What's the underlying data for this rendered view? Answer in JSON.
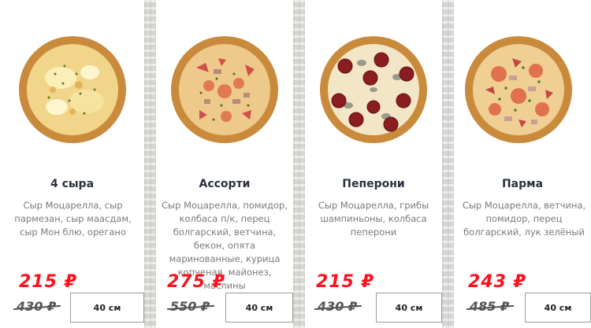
{
  "products": [
    {
      "name": "4 сыра",
      "description": "Сыр Моцарелла, сыр пармезан, сыр маасдам, сыр Мон блю, орегано",
      "price": "215 ₽",
      "old_price": "430 ₽",
      "size": "40 см",
      "image_icon": "pizza-four-cheese"
    },
    {
      "name": "Ассорти",
      "description": "Сыр Моцарелла, помидор, колбаса п/к, перец болгарский, ветчина, бекон, опята маринованные, курица копченая, майонез, маслины",
      "price": "275 ₽",
      "old_price": "550 ₽",
      "size": "40 см",
      "image_icon": "pizza-assorti"
    },
    {
      "name": "Пеперони",
      "description": "Сыр Моцарелла, грибы шампиньоны, колбаса пеперони",
      "price": "215 ₽",
      "old_price": "430 ₽",
      "size": "40 см",
      "image_icon": "pizza-pepperoni"
    },
    {
      "name": "Парма",
      "description": "Сыр Моцарелла, ветчина, помидор, перец болгарский, лук зелёный",
      "price": "243 ₽",
      "old_price": "485 ₽",
      "size": "40 см",
      "image_icon": "pizza-parma"
    }
  ],
  "colors": {
    "price": "#ff0f1c",
    "title": "#2a3140",
    "text": "#7a7a7a"
  }
}
